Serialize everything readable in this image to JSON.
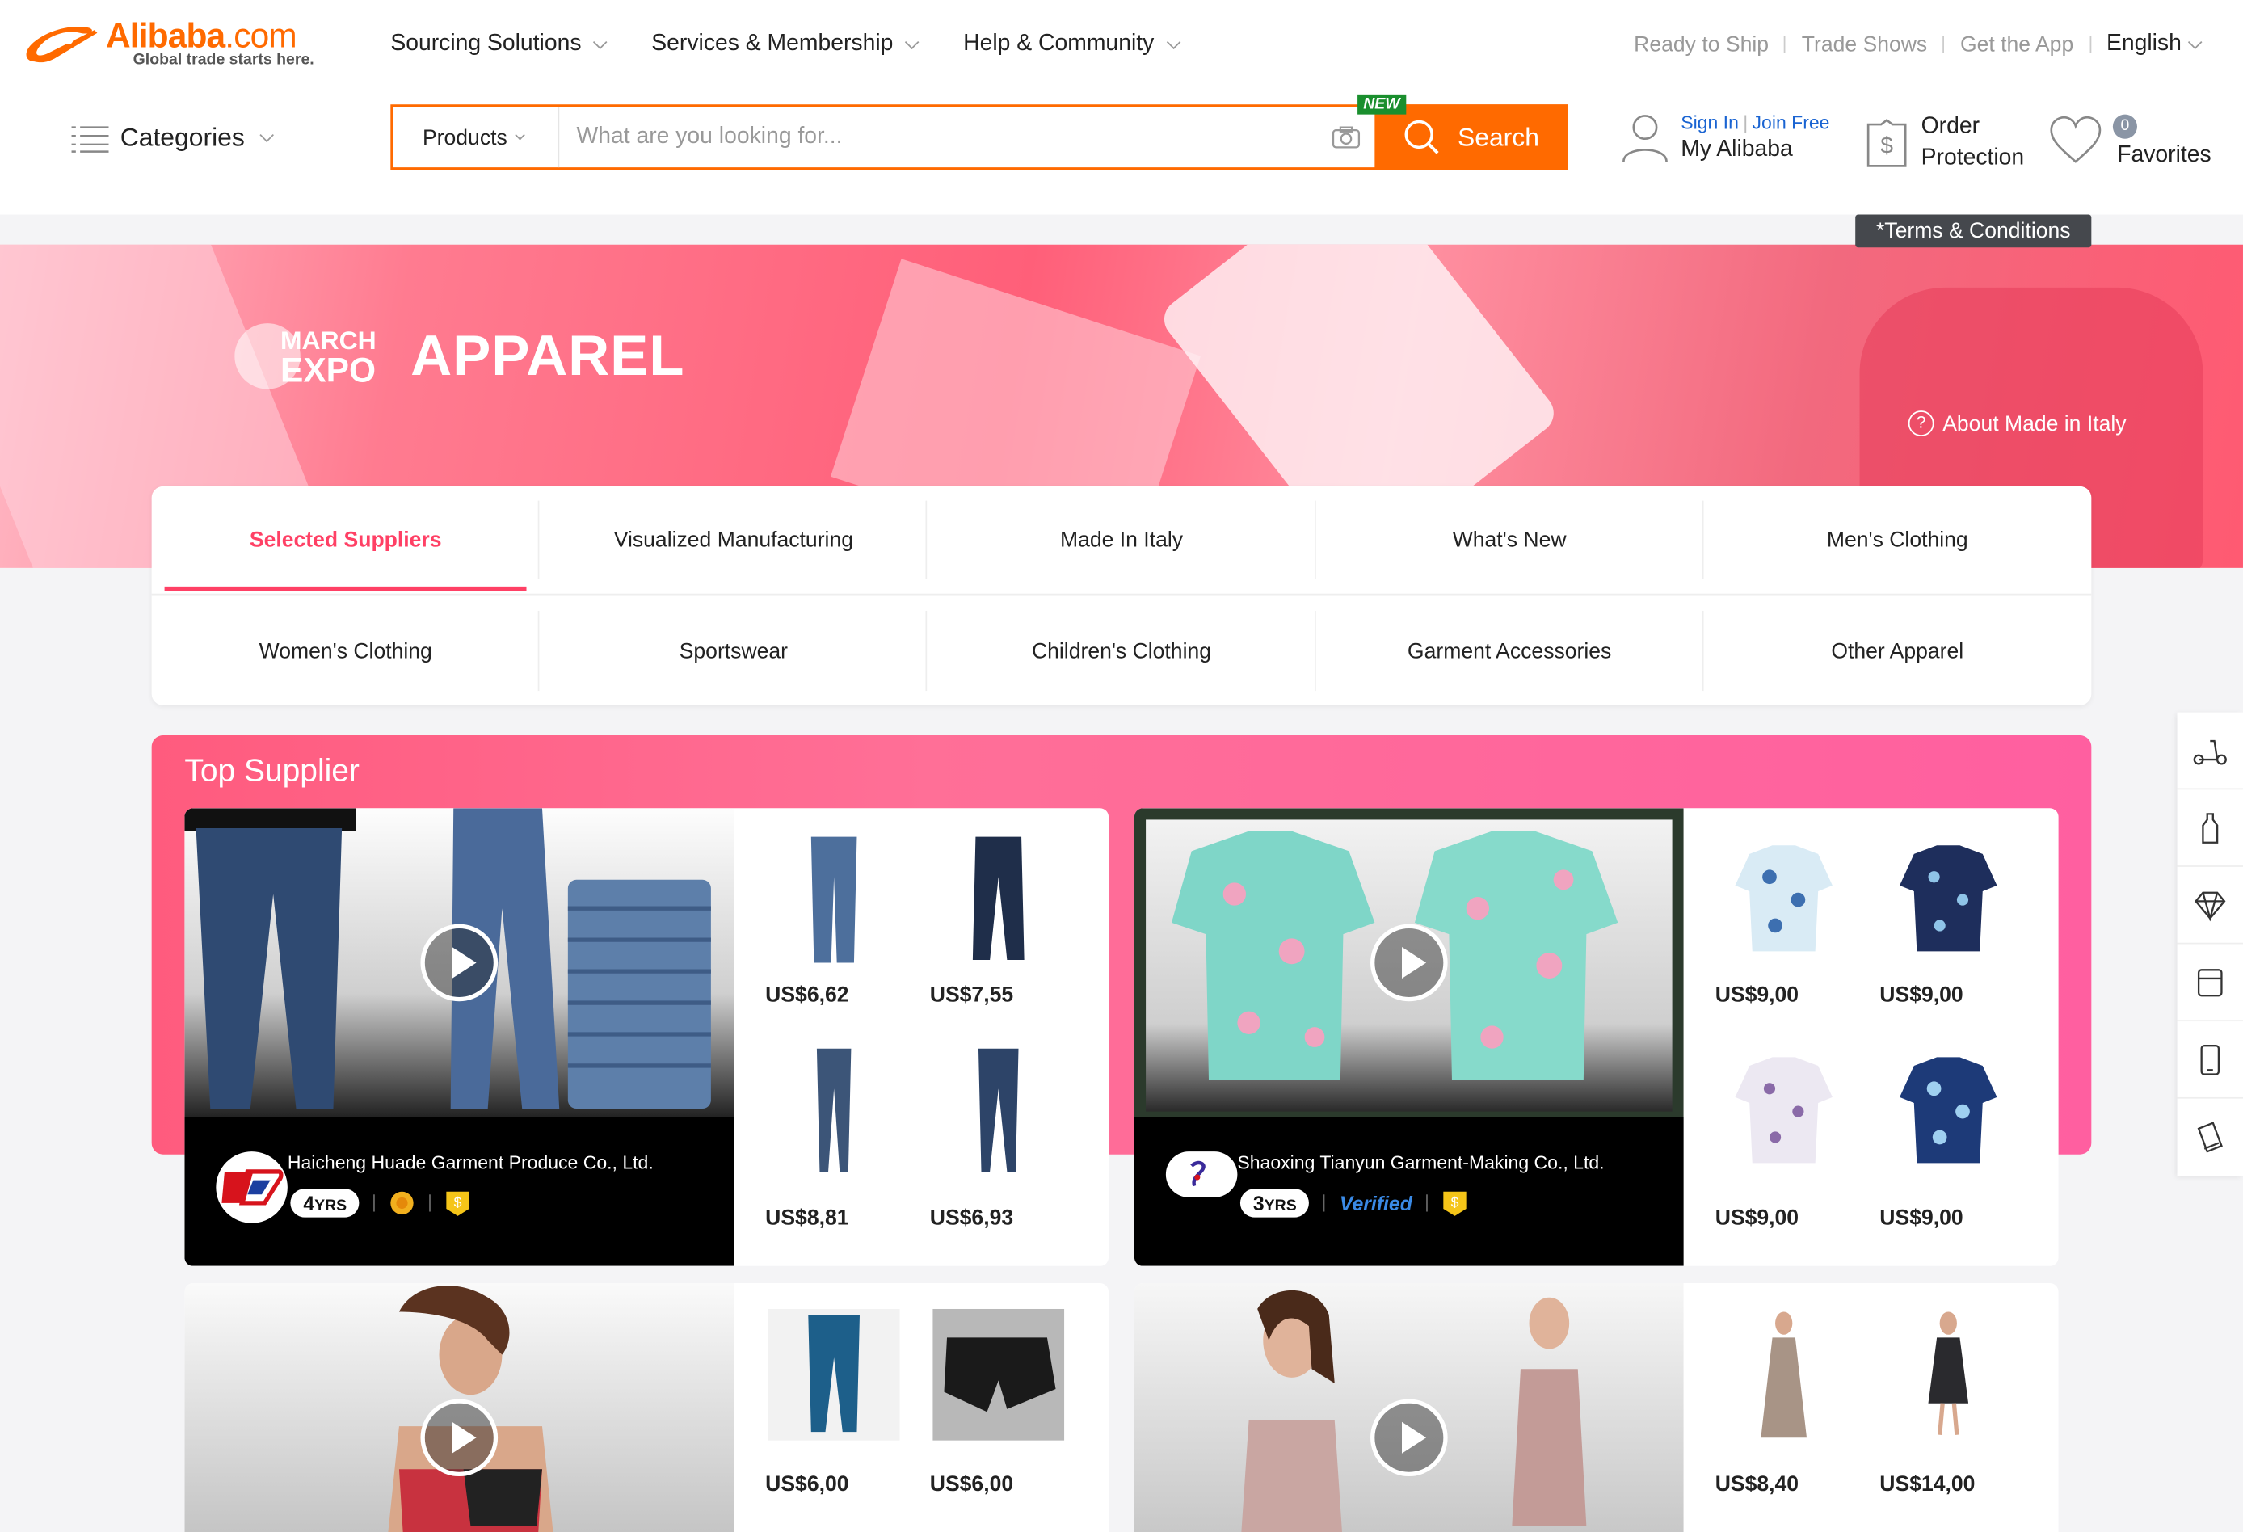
{
  "brand": {
    "name": "Alibaba",
    "tld": ".com",
    "tagline": "Global trade starts here."
  },
  "nav": [
    "Sourcing Solutions",
    "Services & Membership",
    "Help & Community"
  ],
  "toplinks": [
    "Ready to Ship",
    "Trade Shows",
    "Get the App"
  ],
  "language": "English",
  "categories_label": "Categories",
  "search": {
    "type": "Products",
    "placeholder": "What are you looking for...",
    "button": "Search",
    "new_badge": "NEW"
  },
  "account": {
    "sign_in": "Sign In",
    "join": "Join Free",
    "my": "My Alibaba"
  },
  "order": {
    "line1": "Order",
    "line2": "Protection"
  },
  "favorites": {
    "count": "0",
    "label": "Favorites"
  },
  "terms": "*Terms & Conditions",
  "banner": {
    "march": "MARCH",
    "expo": "EXPO",
    "title": "APPAREL",
    "about": "About Made in Italy"
  },
  "tabs_row1": [
    "Selected Suppliers",
    "Visualized Manufacturing",
    "Made In Italy",
    "What's New",
    "Men's Clothing"
  ],
  "tabs_row2": [
    "Women's Clothing",
    "Sportswear",
    "Children's Clothing",
    "Garment Accessories",
    "Other Apparel"
  ],
  "top_supplier": {
    "title": "Top Supplier"
  },
  "suppliers": [
    {
      "name": "Haicheng Huade Garment Produce Co., Ltd.",
      "years": "4",
      "yrs_label": "YRS",
      "prices": [
        "US$6,62",
        "US$7,55",
        "US$8,81",
        "US$6,93"
      ]
    },
    {
      "name": "Shaoxing Tianyun Garment-Making Co., Ltd.",
      "years": "3",
      "yrs_label": "YRS",
      "verified": "Verified",
      "prices": [
        "US$9,00",
        "US$9,00",
        "US$9,00",
        "US$9,00"
      ]
    },
    {
      "prices": [
        "US$6,00",
        "US$6,00"
      ]
    },
    {
      "prices": [
        "US$8,40",
        "US$14,00"
      ]
    }
  ],
  "colors": {
    "accent": "#ff6a00",
    "pink": "#ff4065",
    "link": "#1a64d2"
  },
  "sidebar_icons": [
    "scooter-icon",
    "bottle-icon",
    "diamond-icon",
    "appliance-icon",
    "phone-icon",
    "device-icon"
  ]
}
